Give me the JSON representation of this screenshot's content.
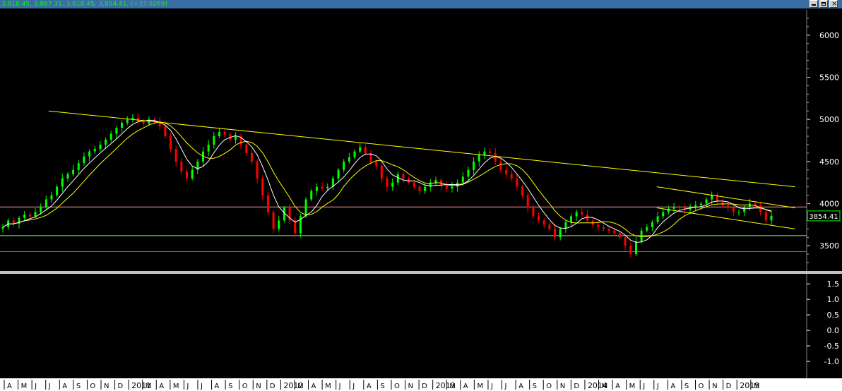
{
  "header": {
    "ohlc_text": "3,818.45, 3,867.31, 3,818.45, 3,854.41, (+33.9269)"
  },
  "price_panel": {
    "y_ticks": [
      "6000",
      "5500",
      "5000",
      "4500",
      "4000",
      "3500"
    ],
    "last_price_label": "3854.41"
  },
  "indicator_panel": {
    "y_ticks": [
      "1.5",
      "1.0",
      "0.5",
      "0.0",
      "-0.5",
      "-1.0"
    ]
  },
  "x_axis": {
    "labels": [
      "A",
      "M",
      "J",
      "J",
      "A",
      "S",
      "O",
      "N",
      "D",
      "2011",
      "M",
      "A",
      "M",
      "J",
      "J",
      "A",
      "S",
      "O",
      "N",
      "D",
      "2012",
      "M",
      "A",
      "M",
      "J",
      "J",
      "A",
      "S",
      "O",
      "N",
      "D",
      "2013",
      "M",
      "A",
      "M",
      "J",
      "J",
      "A",
      "S",
      "O",
      "N",
      "D",
      "2014",
      "M",
      "A",
      "M",
      "J",
      "J",
      "A",
      "S",
      "O",
      "N",
      "D",
      "2015",
      "M"
    ]
  },
  "colors": {
    "background": "#000000",
    "up_candle": "#00ff00",
    "down_candle": "#ff0000",
    "ma_fast": "#ffffff",
    "ma_slow": "#ffff00",
    "trendline": "#ffff00",
    "support_green": "#66ff66",
    "support_red": "#ff3333",
    "resistance_pink": "#ff9999",
    "axis_text": "#ffffff"
  },
  "chart_data": {
    "type": "candlestick",
    "ylim": [
      3200,
      6300
    ],
    "indicator_ylim": [
      -1.5,
      1.8
    ],
    "x_range": [
      "2010-04",
      "2015-02"
    ],
    "price_path_weekly_close": [
      3720,
      3800,
      3760,
      3830,
      3870,
      3850,
      3900,
      3960,
      4050,
      4100,
      4200,
      4300,
      4350,
      4400,
      4480,
      4560,
      4620,
      4650,
      4700,
      4760,
      4830,
      4900,
      4960,
      5000,
      5020,
      4980,
      4950,
      5000,
      4980,
      4920,
      4800,
      4650,
      4500,
      4380,
      4300,
      4400,
      4500,
      4620,
      4700,
      4800,
      4850,
      4820,
      4760,
      4800,
      4700,
      4600,
      4500,
      4300,
      4100,
      3900,
      3700,
      3800,
      3950,
      3800,
      3650,
      3850,
      4050,
      4150,
      4200,
      4180,
      4200,
      4300,
      4400,
      4500,
      4550,
      4620,
      4670,
      4600,
      4500,
      4450,
      4300,
      4200,
      4250,
      4350,
      4300,
      4250,
      4200,
      4150,
      4200,
      4250,
      4280,
      4220,
      4180,
      4200,
      4250,
      4320,
      4400,
      4500,
      4580,
      4620,
      4600,
      4500,
      4400,
      4350,
      4300,
      4200,
      4100,
      3950,
      3850,
      3800,
      3750,
      3700,
      3600,
      3700,
      3780,
      3850,
      3900,
      3870,
      3800,
      3750,
      3720,
      3700,
      3680,
      3650,
      3600,
      3500,
      3400,
      3550,
      3680,
      3720,
      3780,
      3850,
      3900,
      3940,
      3960,
      3950,
      3930,
      3960,
      3980,
      4000,
      4050,
      4100,
      4020,
      3980,
      3950,
      3900,
      3900,
      3960,
      4000,
      3980,
      3900,
      3800,
      3854
    ],
    "trendlines": [
      {
        "from": [
          "2010-07",
          5100
        ],
        "to": [
          "2015-01",
          4200
        ]
      },
      {
        "from": [
          "2014-03",
          4200
        ],
        "to": [
          "2015-01",
          3950
        ]
      },
      {
        "from": [
          "2014-03",
          3950
        ],
        "to": [
          "2015-01",
          3700
        ]
      }
    ],
    "horizontal_levels": [
      {
        "value": 3960,
        "color": "pink"
      },
      {
        "value": 3620,
        "color": "green"
      },
      {
        "value": 3430,
        "color": "red"
      }
    ],
    "last_value": 3854.41
  }
}
